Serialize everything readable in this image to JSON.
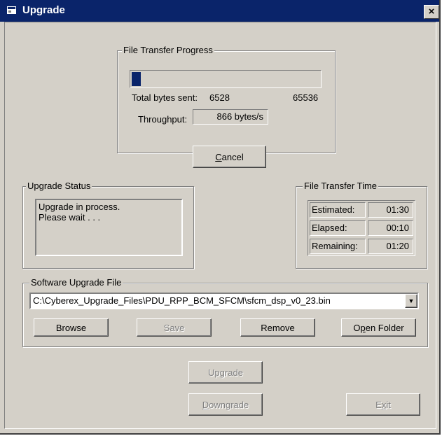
{
  "window": {
    "title": "Upgrade",
    "close_glyph": "×"
  },
  "progress": {
    "legend": "File Transfer Progress",
    "fraction": 0.0996,
    "bytes_sent_label": "Total bytes sent:",
    "bytes_sent": "6528",
    "total_bytes": "65536",
    "throughput_label": "Throughput:",
    "throughput_value": "866 bytes/s"
  },
  "cancel_button": {
    "pre": "",
    "mnemonic": "C",
    "post": "ancel"
  },
  "status": {
    "legend": "Upgrade Status",
    "line1": "Upgrade in process.",
    "line2": "Please wait . . ."
  },
  "time": {
    "legend": "File Transfer Time",
    "estimated_label": "Estimated:",
    "estimated_value": "01:30",
    "elapsed_label": "Elapsed:",
    "elapsed_value": "00:10",
    "remaining_label": "Remaining:",
    "remaining_value": "01:20"
  },
  "file": {
    "legend": "Software Upgrade File",
    "path": "C:\\Cyberex_Upgrade_Files\\PDU_RPP_BCM_SFCM\\sfcm_dsp_v0_23.bin",
    "dropdown_glyph": "▼",
    "browse": "Browse",
    "save": "Save",
    "remove": "Remove",
    "open_folder_pre": "O",
    "open_folder_mnemonic": "p",
    "open_folder_post": "en Folder"
  },
  "actions": {
    "upgrade_pre": "Up",
    "upgrade_mnemonic": "g",
    "upgrade_post": "rade",
    "downgrade_pre": "",
    "downgrade_mnemonic": "D",
    "downgrade_post": "owngrade",
    "exit_pre": "E",
    "exit_mnemonic": "x",
    "exit_post": "it"
  },
  "colors": {
    "titlebar": "#0a246a",
    "face": "#d4d0c8",
    "progress_fill": "#0a246a"
  }
}
